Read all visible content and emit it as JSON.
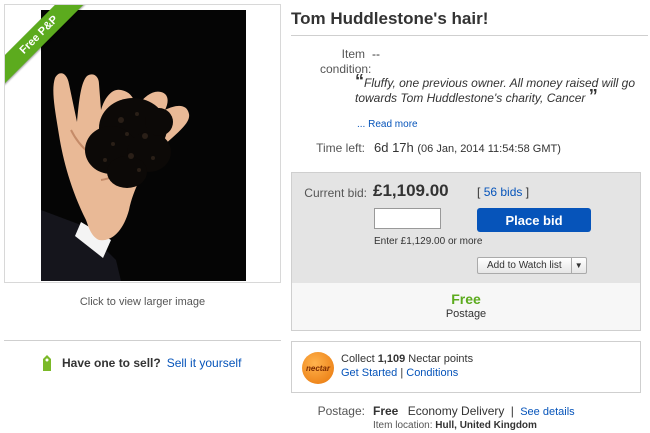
{
  "item": {
    "title": "Tom Huddlestone's hair!",
    "badge": "Free P&P",
    "click_to_view": "Click to view larger image",
    "condition_label": "Item condition:",
    "condition_value": "--",
    "description_quote": "Fluffy, one previous owner. All money raised will go towards Tom Huddlestone's charity, Cancer",
    "read_more": "... Read more",
    "time_left_label": "Time left:",
    "time_left_value": "6d 17h",
    "time_left_date": "(06 Jan, 2014  11:54:58 GMT)"
  },
  "sell": {
    "question": "Have one to sell?",
    "link": "Sell it yourself"
  },
  "bid": {
    "current_label": "Current bid:",
    "current_price": "£1,109.00",
    "bids_open": "[",
    "bids_count": "56 bids",
    "bids_close": "]",
    "input_value": "",
    "place_bid_label": "Place bid",
    "enter_hint": "Enter £1,129.00 or more",
    "watch_label": "Add to Watch list",
    "postage_free": "Free",
    "postage_sub": "Postage"
  },
  "nectar": {
    "logo_text": "nectar",
    "collect_prefix": "Collect",
    "points": "1,109",
    "collect_suffix": "Nectar points",
    "get_started": "Get Started",
    "separator": "|",
    "conditions": "Conditions"
  },
  "postage": {
    "label": "Postage:",
    "free": "Free",
    "method": "Economy Delivery",
    "separator": "|",
    "see_details": "See details",
    "location_label": "Item location:",
    "location_value": "Hull, United Kingdom"
  },
  "colors": {
    "link": "#0654ba",
    "accent_green": "#5cab1e",
    "bid_panel": "#e4e4e4"
  }
}
